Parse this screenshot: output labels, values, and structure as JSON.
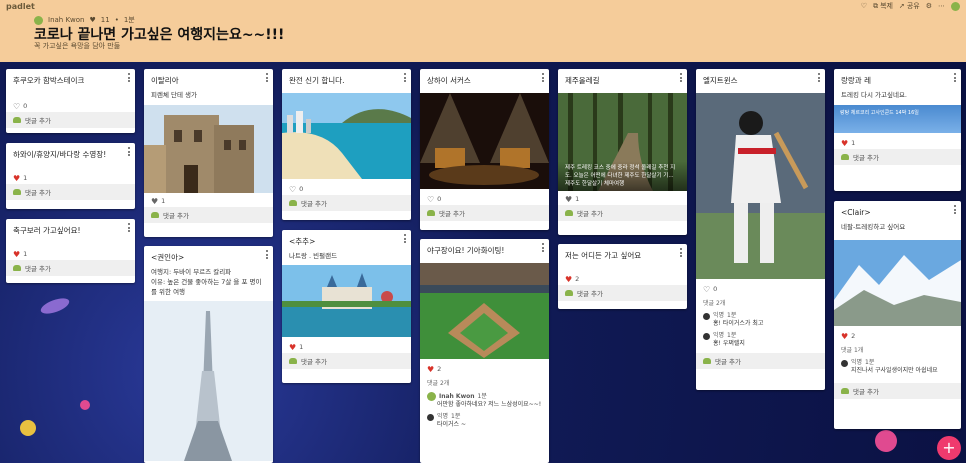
{
  "app": {
    "brand": "padlet"
  },
  "toolbar": {
    "share_label": "공유",
    "wall_label": "복제"
  },
  "header": {
    "author": "Inah Kwon",
    "likes": "11",
    "age": "1분",
    "title": "코로나 끝나면 가고싶은 여행지는요~~!!!",
    "subtitle": "꼭 가고싶은 욕망을 담아 만듦"
  },
  "colors": {
    "header_bg": "#f5cc9a",
    "heart": "#d8332a",
    "accent": "#ef3a6e"
  },
  "common": {
    "add_comment": "댓글 추가"
  },
  "cards": {
    "c1": {
      "title": "후쿠오카 함박스테이크",
      "count": "0"
    },
    "c2": {
      "title": "하와이/휴양지/바다랑 수영장!",
      "count": "1"
    },
    "c3": {
      "title": "축구보러 가고싶어요!",
      "count": "1"
    },
    "c4": {
      "title": "이탈리아",
      "body": "피렌체 단테 생가",
      "count": "1"
    },
    "c5": {
      "title": "<권인아>",
      "body": "여행지: 두바이 부르즈 칼리파\n이유: 높은 건물 좋아하는 7살 을 포 명이를 위한 여행"
    },
    "c6": {
      "title": "완전 신기 합니다.",
      "count": "0"
    },
    "c7": {
      "title": "<추추>",
      "body": "나트랑 . 빈펄랜드",
      "count": "1"
    },
    "c8": {
      "title": "상하이 서커스",
      "count": "0"
    },
    "c9": {
      "title": "야구장이요! 기아화이팅!",
      "count": "2",
      "comments_count": "댓글 2개",
      "comment1_who": "Inah Kwon",
      "comment1_time": "1분",
      "comment1_text": "어만함 좋아하네요? 저느 느삼성이요~~!",
      "comment2_who": "익명",
      "comment2_time": "1분",
      "comment2_text": "타이거스 ~"
    },
    "c10": {
      "title": "제주올레길",
      "caption": "제주 트레킹 코스 중에 중라 정석 올레길 추천 지도. 오늘은 어떤에 다녀한 제주도 한달살기 기...",
      "caption2": "제주도 한달살기 체마여행",
      "count": "1"
    },
    "c11": {
      "title": "저는 어디든 가고 싶어요",
      "count": "2"
    },
    "c12": {
      "title": "엘지트윈스",
      "count": "0",
      "comments_count": "댓글 2개",
      "comment1_who": "익명",
      "comment1_time": "1분",
      "comment1_text": "홍! 타이거스가 최고",
      "comment2_who": "익명",
      "comment2_time": "1분",
      "comment2_text": "홍! 우쩌렐지"
    },
    "c13": {
      "title": "랑랑과 레",
      "body": "트레킹 다시 가고싶네요.",
      "imgtext": "랑탕 체르코리 고사인쿤드 14박 16일",
      "count": "1"
    },
    "c14": {
      "title": "<Clair>",
      "body": "네팔-트레킹하고 싶어요",
      "count": "2",
      "comments_count": "댓글 1개",
      "comment1_who": "익명",
      "comment1_time": "1분",
      "comment1_text": "지진나서 구사일생이지만 아쉽네요"
    }
  }
}
